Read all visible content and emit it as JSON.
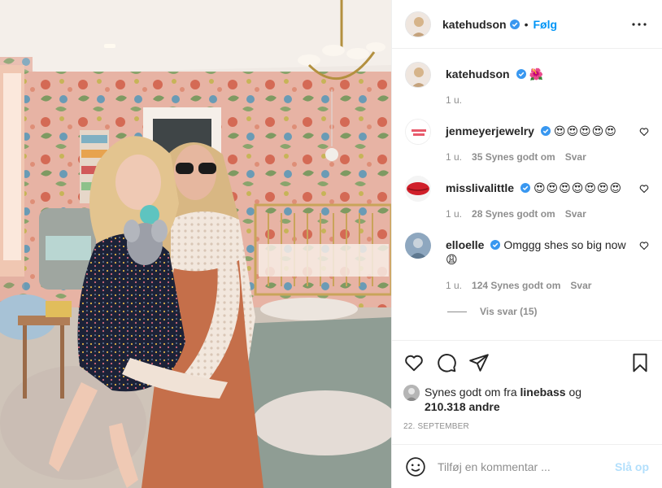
{
  "header": {
    "username": "katehudson",
    "verified": true,
    "dot": "•",
    "follow_label": "Følg",
    "more_icon": "more-horizontal-icon"
  },
  "caption": {
    "username": "katehudson",
    "text": "🌺",
    "time": "1 u."
  },
  "comments": [
    {
      "username": "jenmeyerjewelry",
      "verified": true,
      "text": "😍😍😍😍😍",
      "time": "1 u.",
      "likes": "35 Synes godt om",
      "reply": "Svar"
    },
    {
      "username": "misslivalittle",
      "verified": true,
      "text": "😍😍😍😍😍😍😍",
      "time": "1 u.",
      "likes": "28 Synes godt om",
      "reply": "Svar"
    },
    {
      "username": "elloelle",
      "verified": true,
      "text": "Omggg shes so big now 😩",
      "time": "1 u.",
      "likes": "124 Synes godt om",
      "reply": "Svar"
    }
  ],
  "view_replies": "Vis svar (15)",
  "actions": {
    "like_icon": "heart-icon",
    "comment_icon": "comment-icon",
    "share_icon": "send-icon",
    "save_icon": "bookmark-icon"
  },
  "liked_by": {
    "prefix": "Synes godt om fra",
    "user": "linebass",
    "conj": "og",
    "count": "210.318 andre"
  },
  "date": "22. SEPTEMBER",
  "add_comment": {
    "placeholder": "Tilføj en kommentar ...",
    "post_label": "Slå op",
    "emoji_icon": "smiley-icon"
  },
  "colors": {
    "link_blue": "#0095f6",
    "post_disabled": "#b2dffc",
    "muted": "#8e8e8e",
    "verified": "#3897f0"
  }
}
